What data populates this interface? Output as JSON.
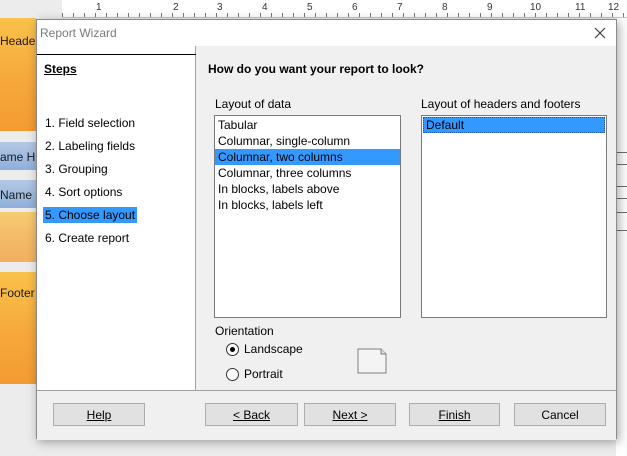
{
  "background": {
    "ruler_numbers": [
      "1",
      "2",
      "3",
      "4",
      "5",
      "6",
      "7",
      "8",
      "9",
      "10",
      "11",
      "12"
    ],
    "sections": {
      "header": "Header",
      "name_h": "ame H...",
      "name_d": "Name ...",
      "footer": "Footer"
    }
  },
  "dialog": {
    "title": "Report Wizard",
    "close_icon": "close-icon"
  },
  "steps": {
    "heading": "Steps",
    "items": [
      {
        "label": "1. Field selection"
      },
      {
        "label": "2. Labeling fields"
      },
      {
        "label": "3. Grouping"
      },
      {
        "label": "4. Sort options"
      },
      {
        "label": "5. Choose layout",
        "selected": true
      },
      {
        "label": "6. Create report"
      }
    ]
  },
  "content": {
    "question": "How do you want your report to look?",
    "layout_data_label": "Layout of data",
    "layout_data_items": [
      "Tabular",
      "Columnar, single-column",
      "Columnar, two columns",
      "Columnar, three columns",
      "In blocks, labels above",
      "In blocks, labels left"
    ],
    "layout_data_selected": "Columnar, two columns",
    "headers_label": "Layout of headers and footers",
    "headers_items": [
      "Default"
    ],
    "orientation_label": "Orientation",
    "landscape_label": "Landscape",
    "portrait_label": "Portrait",
    "orientation_selected": "Landscape"
  },
  "buttons": {
    "help": "Help",
    "back": "< Back",
    "next": "Next >",
    "finish": "Finish",
    "cancel": "Cancel"
  },
  "colors": {
    "selection": "#3399ff",
    "section_orange": "#f6a83b",
    "section_blue": "#8fb0da"
  }
}
